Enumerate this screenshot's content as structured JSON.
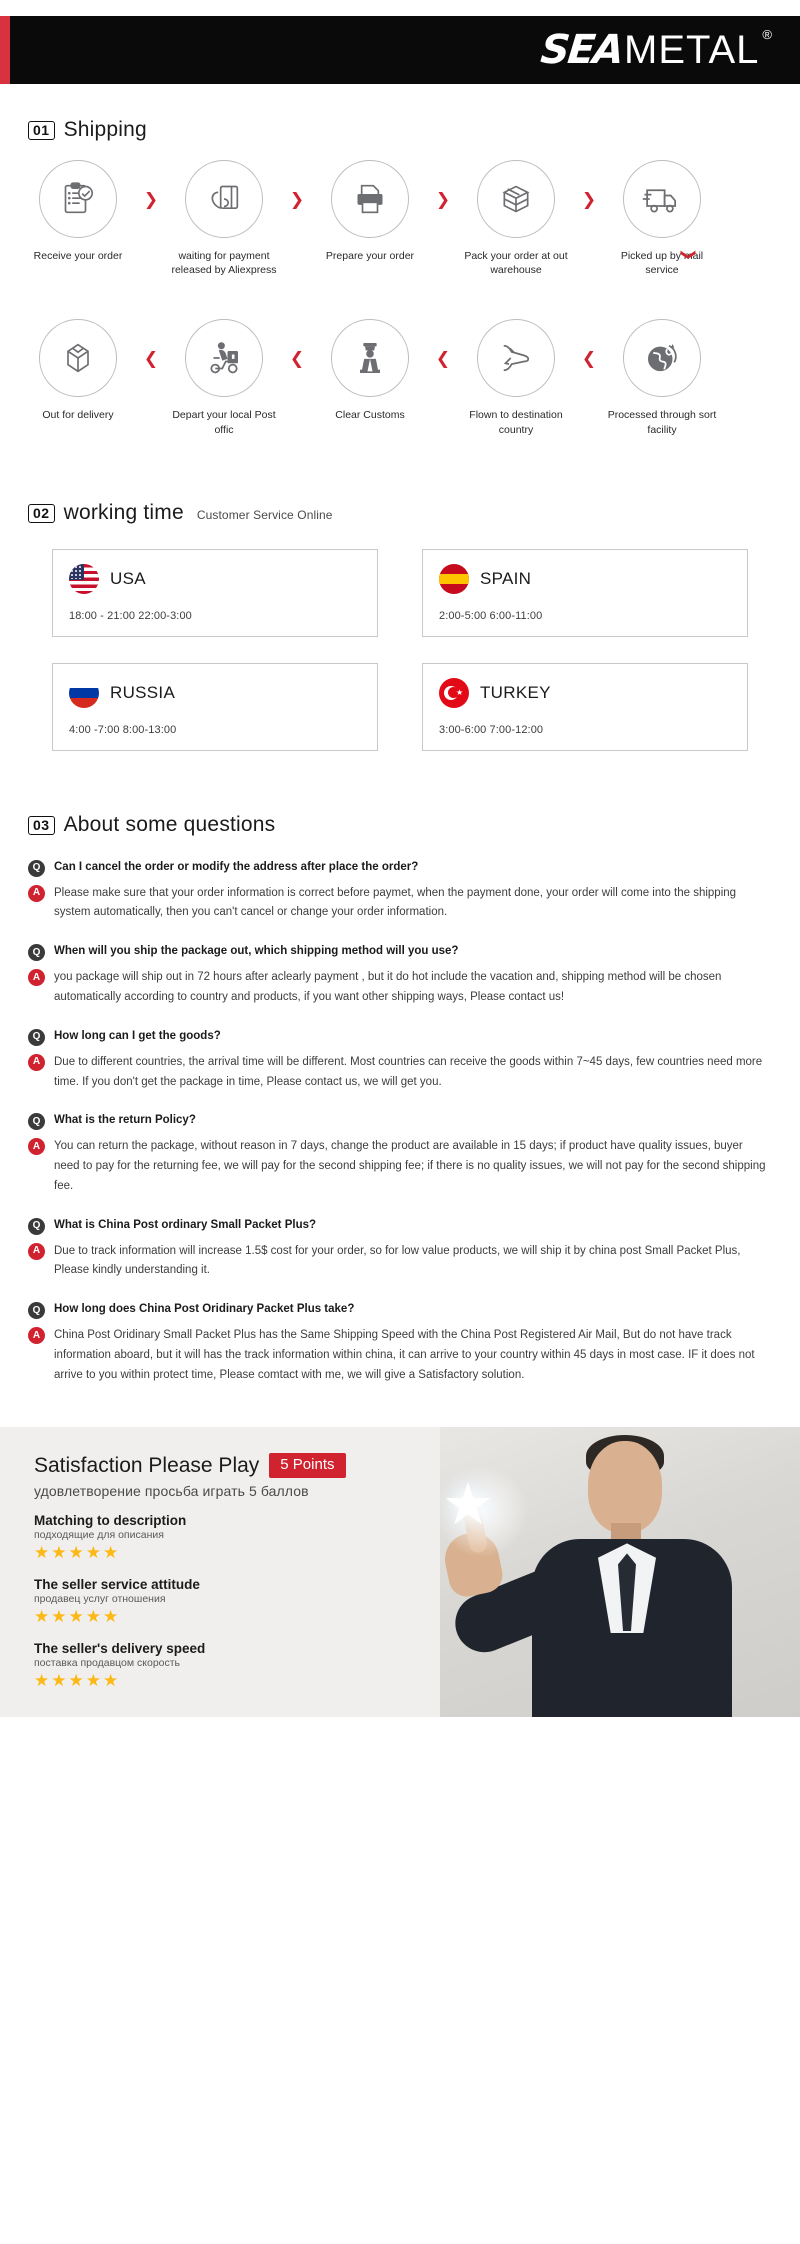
{
  "header": {
    "logo_sea": "SEA",
    "logo_metal": "METAL",
    "registered_mark": "®",
    "accent_color": "#d8313f"
  },
  "shipping": {
    "number": "01",
    "title": "Shipping",
    "arrow_right": "❯",
    "arrow_left": "❮",
    "arrow_down": "❯",
    "row1": [
      {
        "icon": "clipboard-check-icon",
        "label": "Receive your order"
      },
      {
        "icon": "hand-card-icon",
        "label": "waiting for payment released by Aliexpress"
      },
      {
        "icon": "printer-icon",
        "label": "Prepare your order"
      },
      {
        "icon": "box-icon",
        "label": "Pack your order at out warehouse"
      },
      {
        "icon": "truck-icon",
        "label": "Picked up by mail service"
      }
    ],
    "row2": [
      {
        "icon": "open-box-icon",
        "label": "Out  for delivery"
      },
      {
        "icon": "scooter-courier-icon",
        "label": "Depart your local Post offic"
      },
      {
        "icon": "customs-officer-icon",
        "label": "Clear Customs"
      },
      {
        "icon": "airplane-icon",
        "label": "Flown to destination country"
      },
      {
        "icon": "globe-icon",
        "label": "Processed through sort facility"
      }
    ]
  },
  "working_time": {
    "number": "02",
    "title": "working time",
    "subtitle": "Customer Service Online",
    "cards": [
      {
        "flag": "flag-usa-icon",
        "country": "USA",
        "hours": "18:00 - 21:00   22:00-3:00"
      },
      {
        "flag": "flag-spain-icon",
        "country": "SPAIN",
        "hours": "2:00-5:00    6:00-11:00"
      },
      {
        "flag": "flag-russia-icon",
        "country": "RUSSIA",
        "hours": "4:00 -7:00   8:00-13:00"
      },
      {
        "flag": "flag-turkey-icon",
        "country": "TURKEY",
        "hours": "3:00-6:00    7:00-12:00"
      }
    ]
  },
  "faq": {
    "number": "03",
    "title": "About some questions",
    "q_badge": "Q",
    "a_badge": "A",
    "items": [
      {
        "question": "Can I cancel the order or modify the address after place the order?",
        "answer": "Please make sure that your order information is correct before paymet, when the payment done, your order will come into the shipping system automatically, then you can't cancel or change your order information."
      },
      {
        "question": "When will you ship the package out, which shipping method will you use?",
        "answer": "you package will ship out in 72 hours after aclearly payment , but it do hot include the vacation and, shipping method will be chosen automatically according to country and products, if you want other shipping ways, Please contact us!"
      },
      {
        "question": "How long can I get the goods?",
        "answer": "Due to different countries, the arrival time will be different. Most countries can receive the goods within 7~45 days, few countries need more time. If you don't get the package in time, Please contact us, we will get you."
      },
      {
        "question": "What is the return Policy?",
        "answer": "You can return the package, without reason in 7 days, change the product are available in 15 days; if product have quality issues, buyer need to pay for the returning fee, we will pay for the second shipping fee; if there is no quality issues, we will not pay for the second shipping fee."
      },
      {
        "question": "What is China Post ordinary Small Packet Plus?",
        "answer": "Due to track information will increase 1.5$ cost for your order, so for low value products, we will ship it by china post Small Packet Plus, Please kindly understanding it."
      },
      {
        "question": "How long does China Post Oridinary Packet Plus take?",
        "answer": "China Post Oridinary Small Packet Plus has the Same Shipping Speed with the China Post Registered Air Mail, But do not have track information aboard, but it will has the track information within china, it can arrive to your country within 45 days in most case. IF it does not arrive to you within protect time, Please comtact with me, we will give a Satisfactory solution."
      }
    ]
  },
  "footer": {
    "title": "Satisfaction Please Play",
    "points_badge": "5 Points",
    "subtitle_ru": "удовлетворение просьба играть 5 баллов",
    "ratings": [
      {
        "title": "Matching to description",
        "title_ru": "подходящие для описания",
        "stars": "★★★★★",
        "value": 5
      },
      {
        "title": "The seller service attitude",
        "title_ru": "продавец услуг отношения",
        "stars": "★★★★★",
        "value": 5
      },
      {
        "title": "The seller's delivery speed",
        "title_ru": "поставка продавцом скорость",
        "stars": "★★★★★",
        "value": 5
      }
    ],
    "photo": "businessman-pointing-star-photo",
    "star_glyph": "★"
  }
}
